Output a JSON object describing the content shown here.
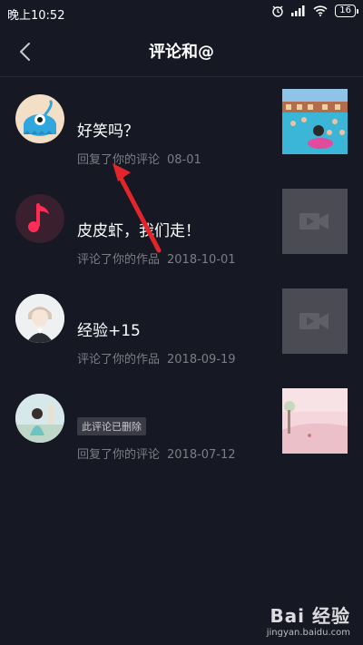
{
  "status_bar": {
    "time": "晚上10:52",
    "battery": "16"
  },
  "header": {
    "title": "评论和@"
  },
  "items": [
    {
      "title": "好笑吗？",
      "action": "回复了你的评论",
      "date": "08-01"
    },
    {
      "title": "皮皮虾，我们走！",
      "action": "评论了你的作品",
      "date": "2018-10-01"
    },
    {
      "title": "经验+15",
      "action": "评论了你的作品",
      "date": "2018-09-19"
    },
    {
      "badge": "此评论已删除",
      "action": "回复了你的评论",
      "date": "2018-07-12"
    }
  ],
  "watermark": {
    "brand": "Bai 经验",
    "url": "jingyan.baidu.com"
  },
  "colors": {
    "background": "#161823",
    "meta_text": "#7c7d85",
    "arrow": "#e1252b",
    "placeholder": "#4a4b53"
  }
}
